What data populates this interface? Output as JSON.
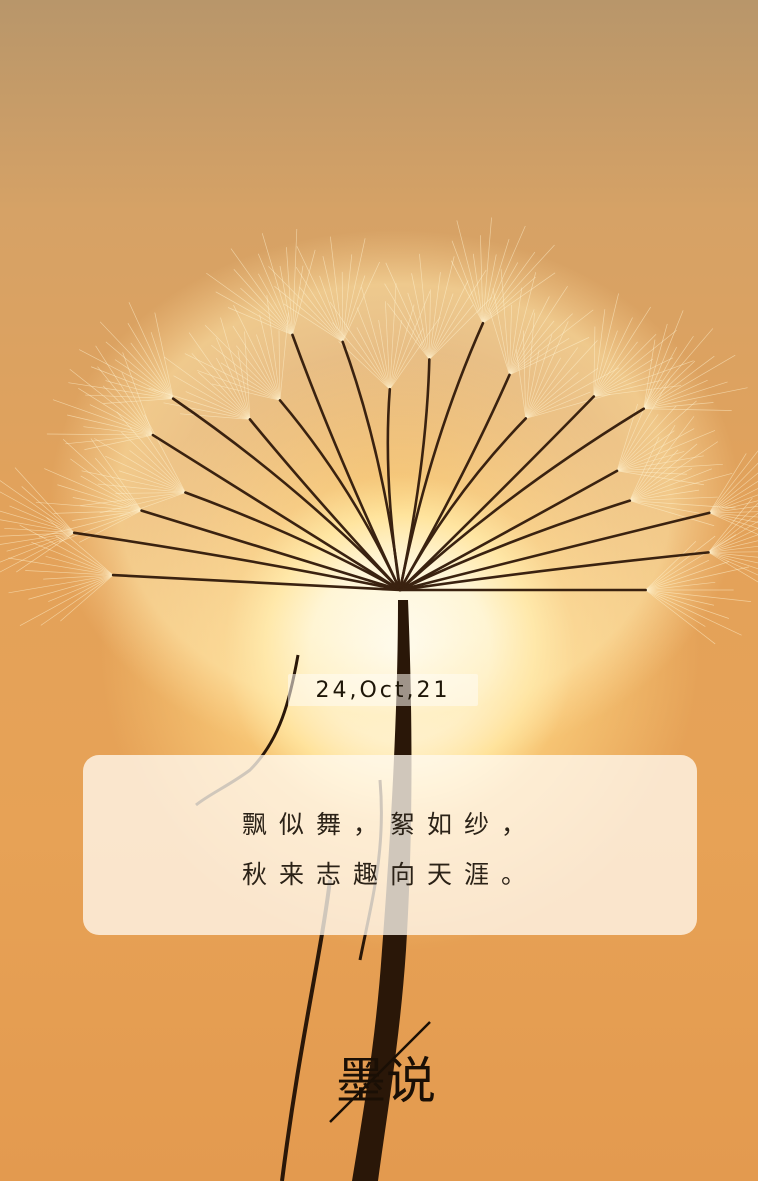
{
  "photo": {
    "subject": "dandelion-seed-head-silhouette-at-sunset",
    "colors": {
      "sky_top": "#b8966a",
      "sky_mid": "#e3a25a",
      "sun_core": "#ffffff",
      "silhouette": "#2a1708"
    }
  },
  "date_label": "24,Oct,21",
  "poem": {
    "line1": "飘似舞，絮如纱，",
    "line2": "秋来志趣向天涯。"
  },
  "signature": {
    "text": "墨说"
  }
}
